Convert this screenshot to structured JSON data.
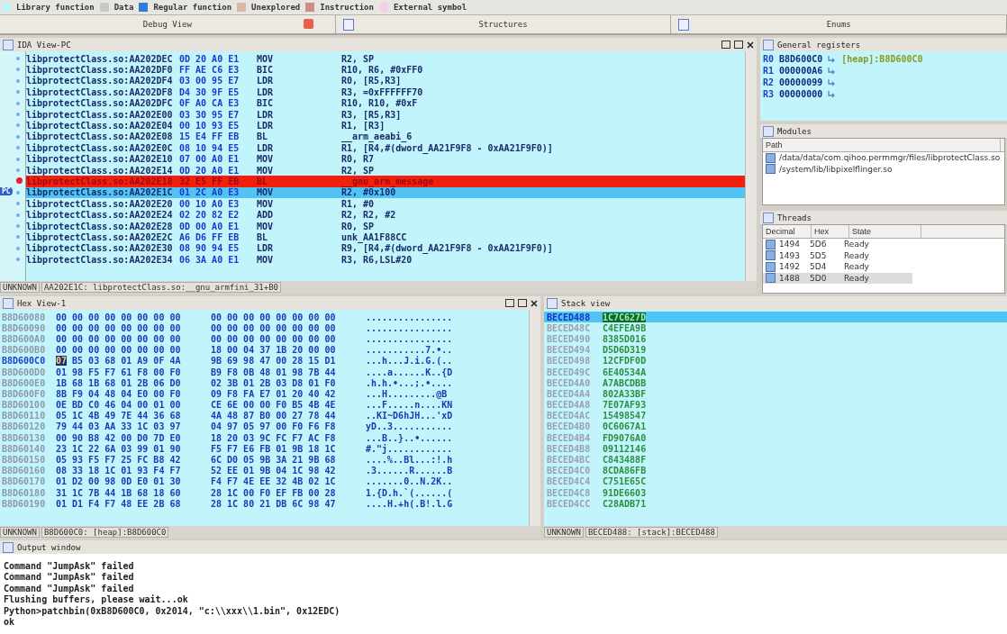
{
  "legend": [
    {
      "label": "Library function",
      "color": "#bff3fb"
    },
    {
      "label": "Data",
      "color": "#c8c8c8"
    },
    {
      "label": "Regular function",
      "color": "#2f7bd8"
    },
    {
      "label": "Unexplored",
      "color": "#d9b8a8"
    },
    {
      "label": "Instruction",
      "color": "#d08a8a"
    },
    {
      "label": "External symbol",
      "color": "#f6d0e6"
    }
  ],
  "tabs": [
    {
      "label": "Debug View",
      "selected": false,
      "closable": true
    },
    {
      "label": "Structures",
      "selected": false,
      "closable": false
    },
    {
      "label": "Enums",
      "selected": false,
      "closable": false
    }
  ],
  "ida_view": {
    "title": "IDA View-PC",
    "pc_label": "PC",
    "lines": [
      {
        "kind": "normal",
        "address": "libprotectClass.so:AA202DEC",
        "bytes": "0D 20 A0 E1",
        "mnemonic": "MOV",
        "operands": "R2, SP"
      },
      {
        "kind": "normal",
        "address": "libprotectClass.so:AA202DF0",
        "bytes": "FF AE C6 E3",
        "mnemonic": "BIC",
        "operands": "R10, R6, #0xFF0"
      },
      {
        "kind": "normal",
        "address": "libprotectClass.so:AA202DF4",
        "bytes": "03 00 95 E7",
        "mnemonic": "LDR",
        "operands": "R0, [R5,R3]"
      },
      {
        "kind": "normal",
        "address": "libprotectClass.so:AA202DF8",
        "bytes": "D4 30 9F E5",
        "mnemonic": "LDR",
        "operands": "R3, =0xFFFFFF70"
      },
      {
        "kind": "normal",
        "address": "libprotectClass.so:AA202DFC",
        "bytes": "0F A0 CA E3",
        "mnemonic": "BIC",
        "operands": "R10, R10, #0xF"
      },
      {
        "kind": "normal",
        "address": "libprotectClass.so:AA202E00",
        "bytes": "03 30 95 E7",
        "mnemonic": "LDR",
        "operands": "R3, [R5,R3]"
      },
      {
        "kind": "normal",
        "address": "libprotectClass.so:AA202E04",
        "bytes": "00 10 93 E5",
        "mnemonic": "LDR",
        "operands": "R1, [R3]"
      },
      {
        "kind": "normal",
        "address": "libprotectClass.so:AA202E08",
        "bytes": "15 E4 FF EB",
        "mnemonic": "BL",
        "operands": "__arm_aeabi_6"
      },
      {
        "kind": "normal",
        "address": "libprotectClass.so:AA202E0C",
        "bytes": "08 10 94 E5",
        "mnemonic": "LDR",
        "operands": "R1, [R4,#(dword_AA21F9F8 - 0xAA21F9F0)]"
      },
      {
        "kind": "normal",
        "address": "libprotectClass.so:AA202E10",
        "bytes": "07 00 A0 E1",
        "mnemonic": "MOV",
        "operands": "R0, R7"
      },
      {
        "kind": "normal",
        "address": "libprotectClass.so:AA202E14",
        "bytes": "0D 20 A0 E1",
        "mnemonic": "MOV",
        "operands": "R2, SP"
      },
      {
        "kind": "breakpoint",
        "address": "libprotectClass.so:AA202E18",
        "bytes": "32 E5 FF EB",
        "mnemonic": "BL",
        "operands": "__gnu_arm_message"
      },
      {
        "kind": "current",
        "address": "libprotectClass.so:AA202E1C",
        "bytes": "01 2C A0 E3",
        "mnemonic": "MOV",
        "operands": "R2, #0x100"
      },
      {
        "kind": "normal",
        "address": "libprotectClass.so:AA202E20",
        "bytes": "00 10 A0 E3",
        "mnemonic": "MOV",
        "operands": "R1, #0"
      },
      {
        "kind": "normal",
        "address": "libprotectClass.so:AA202E24",
        "bytes": "02 20 82 E2",
        "mnemonic": "ADD",
        "operands": "R2, R2, #2"
      },
      {
        "kind": "normal",
        "address": "libprotectClass.so:AA202E28",
        "bytes": "0D 00 A0 E1",
        "mnemonic": "MOV",
        "operands": "R0, SP"
      },
      {
        "kind": "normal",
        "address": "libprotectClass.so:AA202E2C",
        "bytes": "A6 D6 FF EB",
        "mnemonic": "BL",
        "operands": "unk_AA1F88CC"
      },
      {
        "kind": "normal",
        "address": "libprotectClass.so:AA202E30",
        "bytes": "08 90 94 E5",
        "mnemonic": "LDR",
        "operands": "R9, [R4,#(dword_AA21F9F8 - 0xAA21F9F0)]"
      },
      {
        "kind": "normal",
        "address": "libprotectClass.so:AA202E34",
        "bytes": "06 3A A0 E1",
        "mnemonic": "MOV",
        "operands": "R3, R6,LSL#20"
      }
    ],
    "status_type": "UNKNOWN",
    "status": "AA202E1C: libprotectClass.so:__gnu_armfini_31+B0"
  },
  "registers": {
    "title": "General registers",
    "rows": [
      {
        "name": "R0",
        "value": "B8D600C0",
        "note": "[heap]:B8D600C0"
      },
      {
        "name": "R1",
        "value": "000000A6"
      },
      {
        "name": "R2",
        "value": "00000099"
      },
      {
        "name": "R3",
        "value": "00000000"
      }
    ]
  },
  "modules": {
    "title": "Modules",
    "column": "Path",
    "rows": [
      "/data/data/com.qihoo.permmgr/files/libprotectClass.so",
      "/system/lib/libpixelflinger.so"
    ]
  },
  "threads": {
    "title": "Threads",
    "columns": [
      "Decimal",
      "Hex",
      "State"
    ],
    "rows": [
      {
        "decimal": "1494",
        "hex": "5D6",
        "state": "Ready",
        "selected": false
      },
      {
        "decimal": "1493",
        "hex": "5D5",
        "state": "Ready",
        "selected": false
      },
      {
        "decimal": "1492",
        "hex": "5D4",
        "state": "Ready",
        "selected": false
      },
      {
        "decimal": "1488",
        "hex": "5D0",
        "state": "Ready",
        "selected": true
      }
    ]
  },
  "hex_view": {
    "title": "Hex View-1",
    "rows": [
      {
        "address": "B8D60080",
        "bytes_1": "00 00 00 00 00 00 00 00",
        "bytes_2": "00 00 00 00 00 00 00 00",
        "ascii": "................"
      },
      {
        "address": "B8D60090",
        "bytes_1": "00 00 00 00 00 00 00 00",
        "bytes_2": "00 00 00 00 00 00 00 00",
        "ascii": "................"
      },
      {
        "address": "B8D600A0",
        "bytes_1": "00 00 00 00 00 00 00 00",
        "bytes_2": "00 00 00 00 00 00 00 00",
        "ascii": "................"
      },
      {
        "address": "B8D600B0",
        "bytes_1": "00 00 00 00 00 00 00 00",
        "bytes_2": "18 00 04 37 1B 20 00 00",
        "ascii": "...........7.•.."
      },
      {
        "address": "B8D600C0",
        "cursor": "07",
        "bytes_1": "B5 03 68 01 A9 0F 4A",
        "bytes_2": "9B 69 98 47 00 28 15 D1",
        "ascii": "...h...J.i.G.(.."
      },
      {
        "address": "B8D600D0",
        "bytes_1": "01 98 F5 F7 61 F8 00 F0",
        "bytes_2": "B9 F8 0B 48 01 98 7B 44",
        "ascii": "....a......K..{D"
      },
      {
        "address": "B8D600E0",
        "bytes_1": "1B 68 1B 68 01 2B 06 D0",
        "bytes_2": "02 3B 01 2B 03 D8 01 F0",
        "ascii": ".h.h.•...;.•...."
      },
      {
        "address": "B8D600F0",
        "bytes_1": "8B F9 04 48 04 E0 00 F0",
        "bytes_2": "09 F8 FA E7 01 20 40 42",
        "ascii": "...H.........@B"
      },
      {
        "address": "B8D60100",
        "bytes_1": "0E BD C0 46 04 00 01 00",
        "bytes_2": "CE 6E 00 00 F0 B5 4B 4E",
        "ascii": "...F.....n....KN"
      },
      {
        "address": "B8D60110",
        "bytes_1": "05 1C 4B 49 7E 44 36 68",
        "bytes_2": "4A 48 87 B0 00 27 78 44",
        "ascii": "..KI~D6hJH...'xD"
      },
      {
        "address": "B8D60120",
        "bytes_1": "79 44 03 AA 33 1C 03 97",
        "bytes_2": "04 97 05 97 00 F0 F6 F8",
        "ascii": "yD..3..........."
      },
      {
        "address": "B8D60130",
        "bytes_1": "00 90 B8 42 00 D0 7D E0",
        "bytes_2": "18 20 03 9C FC F7 AC F8",
        "ascii": "...B..}..•......"
      },
      {
        "address": "B8D60140",
        "bytes_1": "23 1C 22 6A 03 99 01 90",
        "bytes_2": "F5 F7 E6 FB 01 9B 18 1C",
        "ascii": "#.\"j............"
      },
      {
        "address": "B8D60150",
        "bytes_1": "05 93 F5 F7 25 FC B8 42",
        "bytes_2": "6C D0 05 9B 3A 21 9B 68",
        "ascii": "....%..Bl...:!.h"
      },
      {
        "address": "B8D60160",
        "bytes_1": "08 33 18 1C 01 93 F4 F7",
        "bytes_2": "52 EE 01 9B 04 1C 98 42",
        "ascii": ".3......R......B"
      },
      {
        "address": "B8D60170",
        "bytes_1": "01 D2 00 98 0D E0 01 30",
        "bytes_2": "F4 F7 4E EE 32 4B 02 1C",
        "ascii": ".......0..N.2K.."
      },
      {
        "address": "B8D60180",
        "bytes_1": "31 1C 7B 44 1B 68 18 60",
        "bytes_2": "28 1C 00 F0 EF FB 00 28",
        "ascii": "1.{D.h.`(......("
      },
      {
        "address": "B8D60190",
        "bytes_1": "01 D1 F4 F7 48 EE 2B 68",
        "bytes_2": "28 1C 80 21 DB 6C 98 47",
        "ascii": "....H.+h(.B!.l.G"
      }
    ],
    "status_type": "UNKNOWN",
    "status": "B8D600C0: [heap]:B8D600C0"
  },
  "stack_view": {
    "title": "Stack view",
    "rows": [
      {
        "address": "BECED488",
        "value": "1C7C627D",
        "selected": true
      },
      {
        "address": "BECED48C",
        "value": "C4EFEA9B",
        "selected": false
      },
      {
        "address": "BECED490",
        "value": "8385D016",
        "selected": false
      },
      {
        "address": "BECED494",
        "value": "D5D6D319",
        "selected": false
      },
      {
        "address": "BECED498",
        "value": "12CFDF0D",
        "selected": false
      },
      {
        "address": "BECED49C",
        "value": "6E40534A",
        "selected": false
      },
      {
        "address": "BECED4A0",
        "value": "A7ABCDBB",
        "selected": false
      },
      {
        "address": "BECED4A4",
        "value": "802A33BF",
        "selected": false
      },
      {
        "address": "BECED4A8",
        "value": "7E07AF93",
        "selected": false
      },
      {
        "address": "BECED4AC",
        "value": "15498547",
        "selected": false
      },
      {
        "address": "BECED4B0",
        "value": "0C6067A1",
        "selected": false
      },
      {
        "address": "BECED4B4",
        "value": "FD9076A0",
        "selected": false
      },
      {
        "address": "BECED4B8",
        "value": "09112146",
        "selected": false
      },
      {
        "address": "BECED4BC",
        "value": "C843488F",
        "selected": false
      },
      {
        "address": "BECED4C0",
        "value": "8CDA86FB",
        "selected": false
      },
      {
        "address": "BECED4C4",
        "value": "C751E65C",
        "selected": false
      },
      {
        "address": "BECED4C8",
        "value": "91DE6603",
        "selected": false
      },
      {
        "address": "BECED4CC",
        "value": "C28ADB71",
        "selected": false
      }
    ],
    "status_type": "UNKNOWN",
    "status": "BECED488: [stack]:BECED488"
  },
  "output": {
    "title": "Output window",
    "lines": [
      "Command \"JumpAsk\" failed",
      "Command \"JumpAsk\" failed",
      "Command \"JumpAsk\" failed",
      "Flushing buffers, please wait...ok",
      "Python>patchbin(0xB8D600C0, 0x2014, \"c:\\\\xxx\\\\1.bin\", 0x12EDC)",
      "ok"
    ]
  }
}
